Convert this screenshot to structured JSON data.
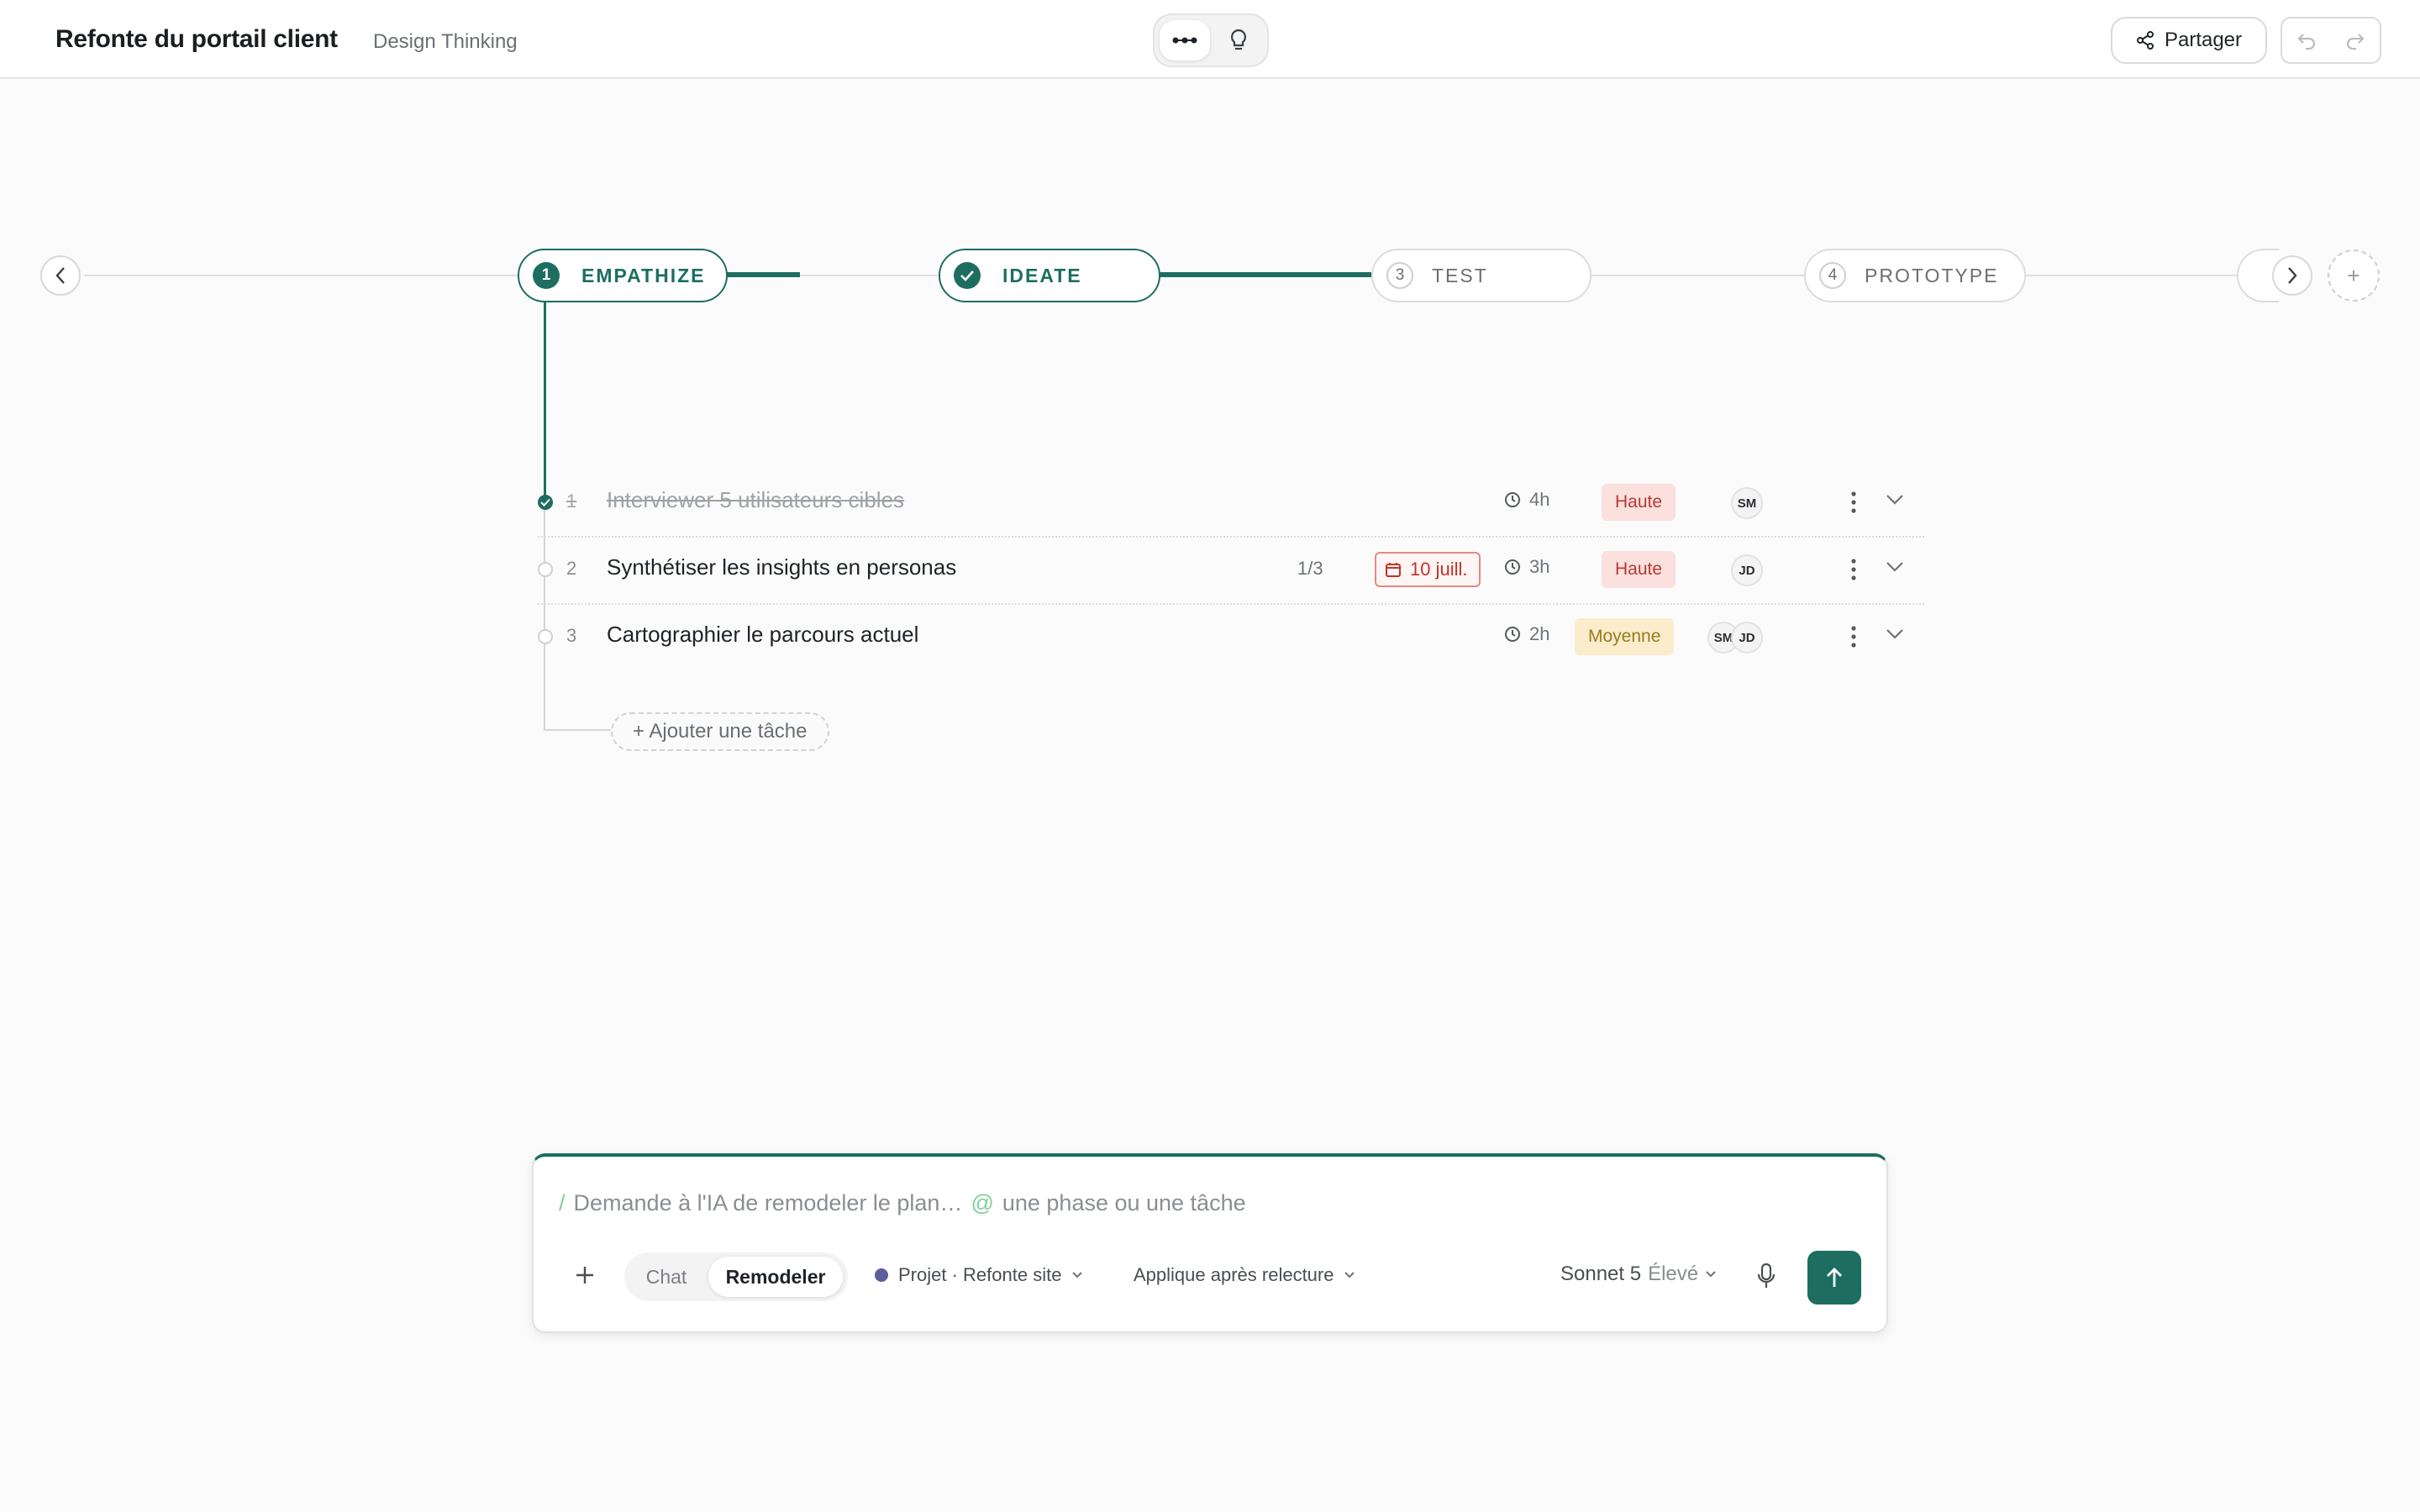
{
  "header": {
    "title": "Refonte du portail client",
    "subtitle": "Design Thinking",
    "share_label": "Partager"
  },
  "colors": {
    "accent": "#1d6e60",
    "high_priority_bg": "#fbe0de",
    "medium_priority_bg": "#fbeccc"
  },
  "phases": [
    {
      "num": "1",
      "label": "EMPATHIZE",
      "state": "active"
    },
    {
      "num": "",
      "label": "IDEATE",
      "state": "done"
    },
    {
      "num": "3",
      "label": "TEST",
      "state": "inactive"
    },
    {
      "num": "4",
      "label": "PROTOTYPE",
      "state": "inactive"
    }
  ],
  "tasks": [
    {
      "num": "1",
      "title": "Interviewer 5 utilisateurs cibles",
      "done": true,
      "hours": "4h",
      "priority": "Haute",
      "assignees": [
        "SM"
      ]
    },
    {
      "num": "2",
      "title": "Synthétiser les insights en personas",
      "done": false,
      "subtasks": "1/3",
      "due": "10 juill.",
      "hours": "3h",
      "priority": "Haute",
      "assignees": [
        "JD"
      ]
    },
    {
      "num": "3",
      "title": "Cartographier le parcours actuel",
      "done": false,
      "hours": "2h",
      "priority": "Moyenne",
      "assignees": [
        "SM",
        "JD"
      ]
    }
  ],
  "add_task_label": "+ Ajouter une tâche",
  "composer": {
    "slash": "/",
    "prompt_part1": "Demande à l'IA de remodeler le plan…",
    "at": "@",
    "prompt_part2": "une phase ou une tâche",
    "mode_chat": "Chat",
    "mode_remodel": "Remodeler",
    "project": "Projet · Refonte site",
    "apply": "Applique après relecture",
    "model": "Sonnet 5",
    "model_level": "Élevé"
  }
}
